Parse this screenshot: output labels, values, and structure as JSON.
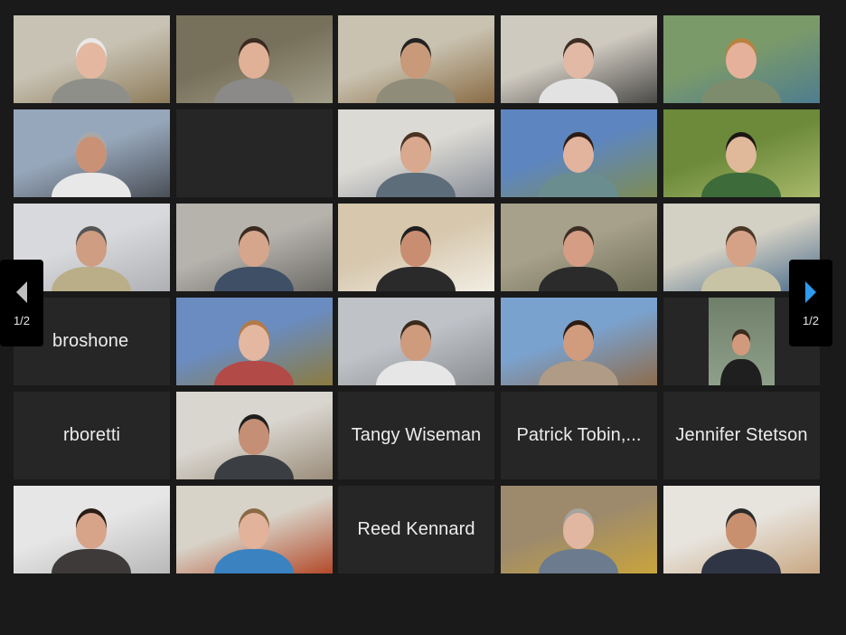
{
  "pager": {
    "left_label": "1/2",
    "right_label": "1/2"
  },
  "participants": [
    {
      "type": "video",
      "bg": "#c8c2b4",
      "bg2": "#8d7c5a",
      "skin": "#e4b8a0",
      "shirt": "#8f8f8a",
      "hair": "#e8e8e8"
    },
    {
      "type": "video",
      "bg": "#77705a",
      "bg2": "#a39f8a",
      "skin": "#e0b196",
      "shirt": "#8b8a88",
      "hair": "#3b2a22"
    },
    {
      "type": "video",
      "bg": "#c9c2b0",
      "bg2": "#8a6c45",
      "skin": "#c99a7a",
      "shirt": "#8f8d79",
      "hair": "#222"
    },
    {
      "type": "video",
      "bg": "#cfcac0",
      "bg2": "#4b4a48",
      "skin": "#e2b9a5",
      "shirt": "#e2e2e2",
      "hair": "#3d2d22"
    },
    {
      "type": "video",
      "bg": "#7b9a6a",
      "bg2": "#4e7d8f",
      "skin": "#e6b19a",
      "shirt": "#7e8c6e",
      "hair": "#b8823f",
      "active": true
    },
    {
      "type": "video",
      "bg": "#97a7bb",
      "bg2": "#4a4f57",
      "skin": "#c99276",
      "shirt": "#e8e8e8",
      "hair": "#a8a8a8"
    },
    {
      "type": "empty"
    },
    {
      "type": "video",
      "bg": "#dcdad4",
      "bg2": "#8a8f99",
      "skin": "#d8a98e",
      "shirt": "#5e6d7a",
      "hair": "#4a3323"
    },
    {
      "type": "video",
      "bg": "#5d86c0",
      "bg2": "#7d8c54",
      "skin": "#e2b39d",
      "shirt": "#6a8e8f",
      "hair": "#2a1c14"
    },
    {
      "type": "video",
      "bg": "#6c8a3a",
      "bg2": "#a8b96b",
      "skin": "#e0b89a",
      "shirt": "#3d6b3a",
      "hair": "#1b1612"
    },
    {
      "type": "video",
      "bg": "#d8d9dc",
      "bg2": "#aeb0b4",
      "skin": "#cf9d82",
      "shirt": "#b9ae88",
      "hair": "#555"
    },
    {
      "type": "video",
      "bg": "#b6b3ad",
      "bg2": "#6d6b66",
      "skin": "#d5a58c",
      "shirt": "#3e4f66",
      "hair": "#3a2a20"
    },
    {
      "type": "video",
      "bg": "#d6c7ad",
      "bg2": "#f2ede3",
      "skin": "#c98e72",
      "shirt": "#2a2a2a",
      "hair": "#1e1e1e"
    },
    {
      "type": "video",
      "bg": "#a7a08a",
      "bg2": "#6f6f56",
      "skin": "#d59d83",
      "shirt": "#2b2b2b",
      "hair": "#3a2e25"
    },
    {
      "type": "video",
      "bg": "#d3d0c4",
      "bg2": "#4a6b8a",
      "skin": "#d6a287",
      "shirt": "#c8c3a4",
      "hair": "#4a3728"
    },
    {
      "type": "name",
      "label": "broshone",
      "align": "left"
    },
    {
      "type": "video",
      "bg": "#6a8cc1",
      "bg2": "#8b7b3e",
      "skin": "#e4b7a0",
      "shirt": "#b24a48",
      "hair": "#b27a48"
    },
    {
      "type": "video",
      "bg": "#bfc3c8",
      "bg2": "#8a8d90",
      "skin": "#cf9b7d",
      "shirt": "#e6e6e6",
      "hair": "#3a2a1c"
    },
    {
      "type": "video",
      "bg": "#7aa2cf",
      "bg2": "#8d6c4c",
      "skin": "#d09c7d",
      "shirt": "#b09b86",
      "hair": "#2c1c12"
    },
    {
      "type": "video",
      "bg": "#2a2a2a",
      "bg2": "#6f7f6a",
      "skin": "#d29a7c",
      "shirt": "#1f1f1f",
      "hair": "#3a2a1e",
      "small": true
    },
    {
      "type": "name",
      "label": "rboretti",
      "align": "center"
    },
    {
      "type": "video",
      "bg": "#d9d6cf",
      "bg2": "#9a8c7a",
      "skin": "#c48f75",
      "shirt": "#3b3f44",
      "hair": "#1e1e1e"
    },
    {
      "type": "name",
      "label": "Tangy Wiseman",
      "align": "center"
    },
    {
      "type": "name",
      "label": "Patrick Tobin,...",
      "align": "center"
    },
    {
      "type": "name",
      "label": "Jennifer Stetson",
      "align": "center"
    },
    {
      "type": "video",
      "bg": "#e6e6e6",
      "bg2": "#b8b8b8",
      "skin": "#d7a48a",
      "shirt": "#3e3a3a",
      "hair": "#2a1c14"
    },
    {
      "type": "video",
      "bg": "#d8d3c8",
      "bg2": "#b34a2a",
      "skin": "#e2b29b",
      "shirt": "#3b83c0",
      "hair": "#8a6a44"
    },
    {
      "type": "name",
      "label": "Reed Kennard",
      "align": "center"
    },
    {
      "type": "video",
      "bg": "#9d8a6c",
      "bg2": "#c9a43c",
      "skin": "#e2b7a2",
      "shirt": "#6c7b8e",
      "hair": "#a7a39d"
    },
    {
      "type": "video",
      "bg": "#e7e4de",
      "bg2": "#c9a883",
      "skin": "#c9906f",
      "shirt": "#2f3544",
      "hair": "#2b2b2b"
    }
  ]
}
